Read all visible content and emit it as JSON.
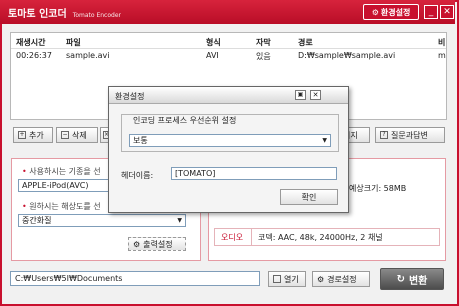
{
  "app": {
    "title": "토마토 인코더",
    "subtitle": "Tomato Encoder",
    "settings_button": "환경설정",
    "minimize": "_",
    "close": "✕"
  },
  "file_table": {
    "columns": [
      "재생시간",
      "파일",
      "형식",
      "자막",
      "경로",
      "비"
    ],
    "rows": [
      {
        "duration": "00:26:37",
        "file": "sample.avi",
        "format": "AVI",
        "subtitle": "있음",
        "path": "D:₩sample₩sample.avi",
        "extra": "m"
      }
    ]
  },
  "toolbar": {
    "add": "추가",
    "delete": "삭제",
    "preview_suffix": "미지",
    "faq": "질문과답변"
  },
  "left_panel": {
    "device_label": "사용하시는 기종을 선",
    "device_value": "APPLE-iPod(AVC)",
    "resolution_label": "원하시는 해상도를 선",
    "resolution_value": "중간화질",
    "output_settings": "출력설정"
  },
  "right_panel": {
    "estimated_size": "예상크기: 58MB",
    "audio_label": "오디오",
    "audio_value": "코덱: AAC, 48k, 24000Hz, 2 채널"
  },
  "bottom": {
    "path": "C:₩Users₩5I₩Documents",
    "open": "열기",
    "path_settings": "경로설정",
    "convert": "변환"
  },
  "dialog": {
    "title": "환경설정",
    "priority_group": "인코딩 프로세스 우선순위 설정",
    "priority_value": "보통",
    "header_label": "헤더이름:",
    "header_value": "[TOMATO]",
    "ok": "확인"
  }
}
